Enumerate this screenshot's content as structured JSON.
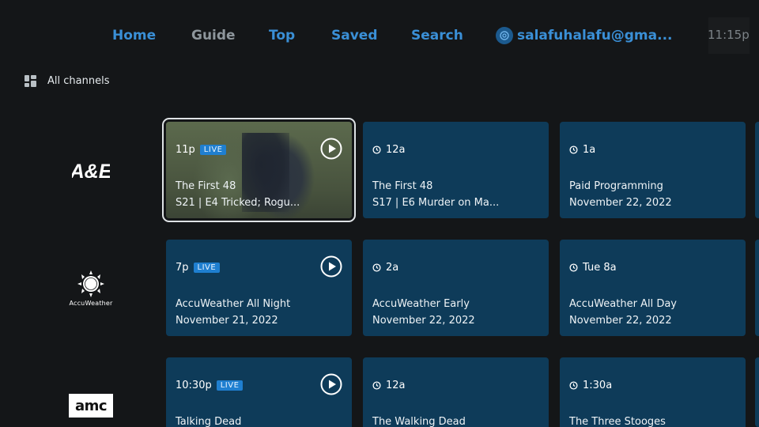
{
  "nav": {
    "home": "Home",
    "guide": "Guide",
    "top": "Top",
    "saved": "Saved",
    "search": "Search",
    "account": "salafuhalafu@gma...",
    "clock": "11:15p"
  },
  "filter": {
    "label": "All channels"
  },
  "channels": [
    {
      "logo_text": "A&E",
      "programs": [
        {
          "time": "11p",
          "live": "LIVE",
          "title": "The First 48",
          "subtitle": "S21 | E4 Tricked; Rogu..."
        },
        {
          "time": "12a",
          "title": "The First 48",
          "subtitle": "S17 | E6 Murder on Ma..."
        },
        {
          "time": "1a",
          "title": "Paid Programming",
          "subtitle": "November 22, 2022"
        }
      ]
    },
    {
      "logo_text": "AccuWeather",
      "programs": [
        {
          "time": "7p",
          "live": "LIVE",
          "title": "AccuWeather All Night",
          "subtitle": "November 21, 2022"
        },
        {
          "time": "2a",
          "title": "AccuWeather Early",
          "subtitle": "November 22, 2022"
        },
        {
          "time": "Tue 8a",
          "title": "AccuWeather All Day",
          "subtitle": "November 22, 2022"
        }
      ]
    },
    {
      "logo_text": "amc",
      "programs": [
        {
          "time": "10:30p",
          "live": "LIVE",
          "title": "Talking Dead"
        },
        {
          "time": "12a",
          "title": "The Walking Dead"
        },
        {
          "time": "1:30a",
          "title": "The Three Stooges"
        }
      ]
    }
  ],
  "colors": {
    "background": "#141618",
    "nav_active": "#3a8fd6",
    "tile": "#0e3b59",
    "live_badge": "#1f7fd0"
  }
}
